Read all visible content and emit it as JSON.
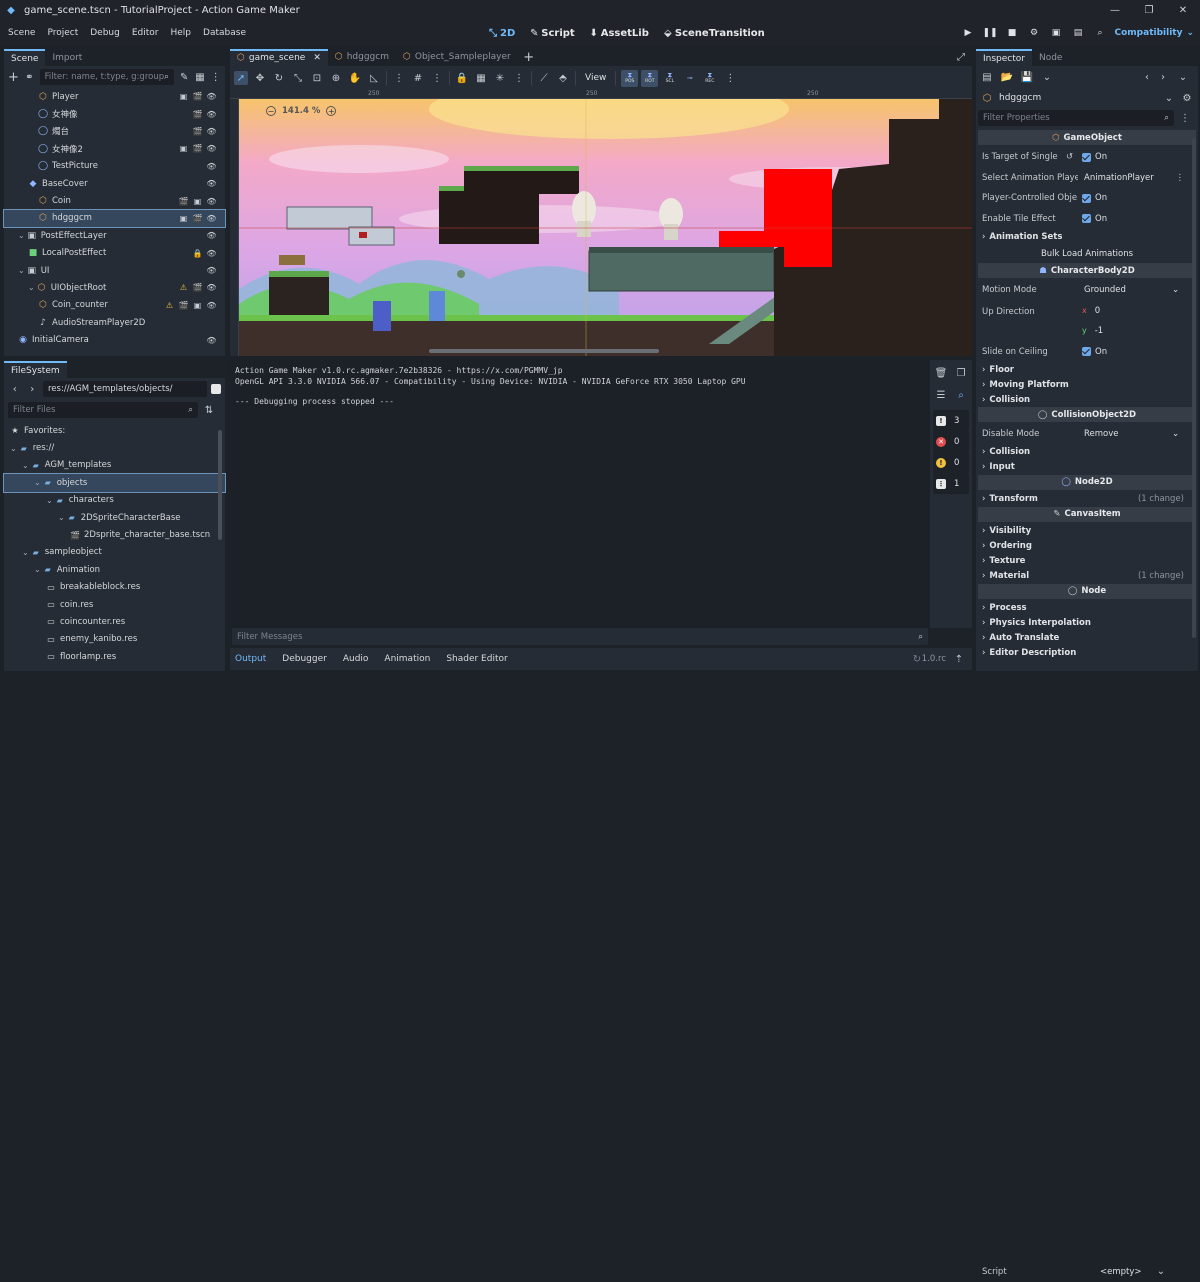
{
  "window": {
    "title": "game_scene.tscn - TutorialProject - Action Game Maker"
  },
  "menu": [
    "Scene",
    "Project",
    "Debug",
    "Editor",
    "Help",
    "Database"
  ],
  "workspaces": [
    {
      "label": "2D",
      "icon": "2d-icon",
      "active": true
    },
    {
      "label": "Script",
      "icon": "script-icon",
      "active": false
    },
    {
      "label": "AssetLib",
      "icon": "assetlib-icon",
      "active": false
    },
    {
      "label": "SceneTransition",
      "icon": "scene-transition-icon",
      "active": false
    }
  ],
  "renderer": "Compatibility",
  "scene_dock": {
    "tabs": [
      "Scene",
      "Import"
    ],
    "filter_placeholder": "Filter: name, t:type, g:group",
    "nodes": [
      {
        "name": "Player",
        "indent": 3,
        "icon": "⬡",
        "icolor": "#e0a060",
        "right": [
          "▣",
          "🎬",
          "👁"
        ]
      },
      {
        "name": "女神像",
        "indent": 3,
        "icon": "◯",
        "icolor": "#8fb6ff",
        "right": [
          "🎬",
          "👁"
        ]
      },
      {
        "name": "燭台",
        "indent": 3,
        "icon": "◯",
        "icolor": "#8fb6ff",
        "right": [
          "🎬",
          "👁"
        ]
      },
      {
        "name": "女神像2",
        "indent": 3,
        "icon": "◯",
        "icolor": "#8fb6ff",
        "right": [
          "▣",
          "🎬",
          "👁"
        ]
      },
      {
        "name": "TestPicture",
        "indent": 3,
        "icon": "◯",
        "icolor": "#8fb6ff",
        "right": [
          "👁"
        ]
      },
      {
        "name": "BaseCover",
        "indent": 2,
        "icon": "◆",
        "icolor": "#8fb6ff",
        "right": [
          "👁"
        ]
      },
      {
        "name": "Coin",
        "indent": 3,
        "icon": "⬡",
        "icolor": "#e0a060",
        "right": [
          "🎬",
          "▣",
          "👁"
        ]
      },
      {
        "name": "hdgggcm",
        "indent": 3,
        "icon": "⬡",
        "icolor": "#e0a060",
        "right": [
          "▣",
          "🎬",
          "👁"
        ],
        "selected": true
      },
      {
        "name": "PostEffectLayer",
        "indent": 1,
        "icon": "▣",
        "icolor": "#c8ccd2",
        "right": [
          "👁"
        ],
        "expand": "v"
      },
      {
        "name": "LocalPostEffect",
        "indent": 2,
        "icon": "■",
        "icolor": "#6ad07a",
        "right": [
          "🔒",
          "👁"
        ]
      },
      {
        "name": "UI",
        "indent": 1,
        "icon": "▣",
        "icolor": "#c8ccd2",
        "right": [
          "👁"
        ],
        "expand": "v"
      },
      {
        "name": "UIObjectRoot",
        "indent": 2,
        "icon": "⬡",
        "icolor": "#e0a060",
        "right": [
          "⚠",
          "🎬",
          "👁"
        ],
        "expand": "v"
      },
      {
        "name": "Coin_counter",
        "indent": 3,
        "icon": "⬡",
        "icolor": "#e0a060",
        "right": [
          "⚠",
          "🎬",
          "▣",
          "👁"
        ]
      },
      {
        "name": "AudioStreamPlayer2D",
        "indent": 3,
        "icon": "♪",
        "icolor": "#c8ccd2",
        "right": []
      },
      {
        "name": "InitialCamera",
        "indent": 1,
        "icon": "◉",
        "icolor": "#8fb6ff",
        "right": [
          "👁"
        ]
      }
    ]
  },
  "filesystem": {
    "tab": "FileSystem",
    "path": "res://AGM_templates/objects/",
    "filter_placeholder": "Filter Files",
    "items": [
      {
        "name": "Favorites:",
        "indent": 0,
        "icon": "★",
        "icolor": "#d7dade"
      },
      {
        "name": "res://",
        "indent": 0,
        "icon": "📁",
        "icolor": "#7ab0e0",
        "expand": "v"
      },
      {
        "name": "AGM_templates",
        "indent": 1,
        "icon": "📁",
        "icolor": "#7ab0e0",
        "expand": "v"
      },
      {
        "name": "objects",
        "indent": 2,
        "icon": "📁",
        "icolor": "#7ab0e0",
        "expand": "v",
        "selected": true
      },
      {
        "name": "characters",
        "indent": 3,
        "icon": "📁",
        "icolor": "#7ab0e0",
        "expand": "v"
      },
      {
        "name": "2DSpriteCharacterBase",
        "indent": 4,
        "icon": "📁",
        "icolor": "#7ab0e0",
        "expand": "v"
      },
      {
        "name": "2Dsprite_character_base.tscn",
        "indent": 5,
        "icon": "🎬",
        "icolor": "#d7dade"
      },
      {
        "name": "sampleobject",
        "indent": 1,
        "icon": "📁",
        "icolor": "#7ab0e0",
        "expand": "v"
      },
      {
        "name": "Animation",
        "indent": 2,
        "icon": "📁",
        "icolor": "#7ab0e0",
        "expand": "v"
      },
      {
        "name": "breakableblock.res",
        "indent": 3,
        "icon": "▭",
        "icolor": "#d7dade"
      },
      {
        "name": "coin.res",
        "indent": 3,
        "icon": "▭",
        "icolor": "#d7dade"
      },
      {
        "name": "coincounter.res",
        "indent": 3,
        "icon": "▭",
        "icolor": "#d7dade"
      },
      {
        "name": "enemy_kanibo.res",
        "indent": 3,
        "icon": "▭",
        "icolor": "#d7dade"
      },
      {
        "name": "floorlamp.res",
        "indent": 3,
        "icon": "▭",
        "icolor": "#d7dade"
      }
    ]
  },
  "editor_tabs": [
    "game_scene",
    "hdgggcm",
    "Object_Sampleplayer"
  ],
  "toolbar": {
    "view_label": "View",
    "agm_buttons": [
      "POS",
      "ROT",
      "SCL",
      "",
      "REC"
    ]
  },
  "viewport": {
    "zoom": "141.4 %",
    "ruler_marks": [
      "250",
      "250",
      "250"
    ]
  },
  "console": {
    "lines": [
      "Action Game Maker v1.0.rc.agmaker.7e2b38326 - https://x.com/PGMMV_jp",
      "OpenGL API 3.3.0 NVIDIA 566.07 - Compatibility - Using Device: NVIDIA - NVIDIA GeForce RTX 3050 Laptop GPU",
      "",
      "--- Debugging process stopped ---"
    ],
    "filter_placeholder": "Filter Messages",
    "counts": [
      "3",
      "0",
      "0",
      "1"
    ],
    "bottom_tabs": [
      "Output",
      "Debugger",
      "Audio",
      "Animation",
      "Shader Editor"
    ],
    "version": "1.0.rc"
  },
  "inspector": {
    "tabs": [
      "Inspector",
      "Node"
    ],
    "object_name": "hdgggcm",
    "filter_placeholder": "Filter Properties",
    "rows": [
      {
        "kind": "section",
        "label": "GameObject",
        "icon": "⬡",
        "icolor": "#e0a060"
      },
      {
        "kind": "check",
        "label": "Is Target of Single",
        "value": "On",
        "reset": true
      },
      {
        "kind": "dropdown",
        "label": "Select Animation Playe",
        "value": "AnimationPlayer",
        "more": true
      },
      {
        "kind": "check",
        "label": "Player-Controlled Obje",
        "value": "On"
      },
      {
        "kind": "check",
        "label": "Enable Tile Effect",
        "value": "On"
      },
      {
        "kind": "group",
        "label": "Animation Sets"
      },
      {
        "kind": "button",
        "label": "Bulk Load Animations"
      },
      {
        "kind": "section",
        "label": "CharacterBody2D",
        "icon": "☗",
        "icolor": "#8fb6ff"
      },
      {
        "kind": "dropdown",
        "label": "Motion Mode",
        "value": "Grounded"
      },
      {
        "kind": "vector",
        "label": "Up Direction",
        "x": "0",
        "y": "-1"
      },
      {
        "kind": "check",
        "label": "Slide on Ceiling",
        "value": "On"
      },
      {
        "kind": "group",
        "label": "Floor"
      },
      {
        "kind": "group",
        "label": "Moving Platform"
      },
      {
        "kind": "group",
        "label": "Collision"
      },
      {
        "kind": "section",
        "label": "CollisionObject2D",
        "icon": "◯",
        "icolor": "#c8ccd2"
      },
      {
        "kind": "dropdown",
        "label": "Disable Mode",
        "value": "Remove"
      },
      {
        "kind": "group",
        "label": "Collision"
      },
      {
        "kind": "group",
        "label": "Input"
      },
      {
        "kind": "section",
        "label": "Node2D",
        "icon": "◯",
        "icolor": "#8fb6ff"
      },
      {
        "kind": "group",
        "label": "Transform",
        "change": "(1 change)"
      },
      {
        "kind": "section",
        "label": "CanvasItem",
        "icon": "✎",
        "icolor": "#c8ccd2"
      },
      {
        "kind": "group",
        "label": "Visibility"
      },
      {
        "kind": "group",
        "label": "Ordering"
      },
      {
        "kind": "group",
        "label": "Texture"
      },
      {
        "kind": "group",
        "label": "Material",
        "change": "(1 change)"
      },
      {
        "kind": "section",
        "label": "Node",
        "icon": "◯",
        "icolor": "#c8ccd2"
      },
      {
        "kind": "group",
        "label": "Process"
      },
      {
        "kind": "group",
        "label": "Physics Interpolation"
      },
      {
        "kind": "group",
        "label": "Auto Translate"
      },
      {
        "kind": "group",
        "label": "Editor Description"
      }
    ],
    "script_label": "Script",
    "script_value": "<empty>"
  },
  "colors": {
    "accent": "#70bafa",
    "panel": "#262c35",
    "bg": "#1d2229",
    "selection": "#35475c"
  }
}
